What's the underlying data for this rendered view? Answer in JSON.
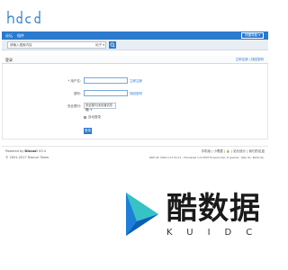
{
  "logo": {
    "text": "hdcd",
    "icon": "hdcd-handwritten-logo"
  },
  "nav": {
    "items": [
      "论坛",
      "插件"
    ],
    "right_button": "快捷导航 ▾"
  },
  "search": {
    "placeholder": "请输入搜索内容",
    "type_label": "帖子 ▾",
    "button_icon": "search-icon"
  },
  "page": {
    "title": "登录",
    "right_links": "立即注册 | 找回密码"
  },
  "form": {
    "username_label": "* 用户名:",
    "username_link": "立即注册",
    "password_label": "密码:",
    "password_link": "找回密码",
    "question_label": "安全提问:",
    "question_value": "安全提问(未设置请忽略) ▾",
    "remember_label": "自动登录",
    "submit_label": "登录"
  },
  "footer": {
    "powered_prefix": "Powered by",
    "powered_name": "Discuz!",
    "version": "X3.4",
    "copyright": "© 2001-2017 Discuz! Team.",
    "links": "手机版 | 小黑屋 | 🔒 | 站长统计 | 我们的足迹",
    "gmt": "GMT+8, 2024-1-13 21:11 , Processed in 0.050779 second(s), 8 queries , Gzip On, Redis On."
  },
  "watermark": {
    "brand": "酷数据",
    "sub": "KUIDC",
    "icon": "play-triangle-logo",
    "colors": {
      "blue": "#1e7fd8",
      "teal": "#37c3c6",
      "dark": "#1a1a1a"
    }
  },
  "colors": {
    "accent": "#2b7acd"
  }
}
